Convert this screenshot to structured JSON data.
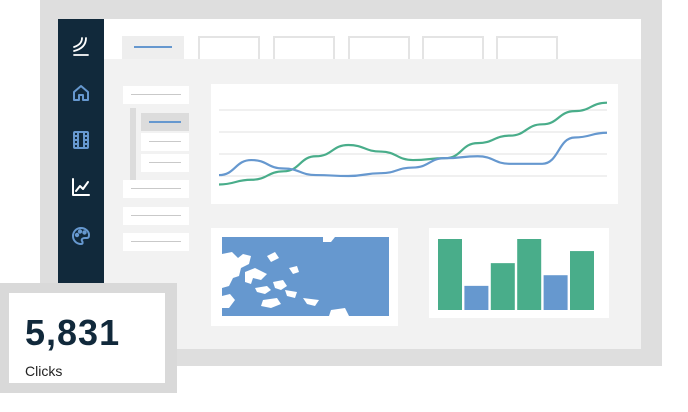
{
  "colors": {
    "sidebar": "#11293b",
    "icon": "#6698cf",
    "green": "#49ad8a",
    "blue": "#6698cf",
    "frame": "#dedede"
  },
  "sidebar": {
    "icons": [
      "logo-icon",
      "home-icon",
      "film-icon",
      "chart-icon",
      "palette-icon"
    ]
  },
  "tabs": {
    "count": 6,
    "active_index": 0
  },
  "line_chart": {
    "type": "line",
    "series": [
      {
        "color": "#49ad8a",
        "values": [
          0.08,
          0.13,
          0.22,
          0.38,
          0.5,
          0.43,
          0.34,
          0.36,
          0.52,
          0.6,
          0.72,
          0.86,
          0.95
        ]
      },
      {
        "color": "#6698cf",
        "values": [
          0.18,
          0.34,
          0.25,
          0.18,
          0.17,
          0.2,
          0.26,
          0.36,
          0.38,
          0.3,
          0.3,
          0.58,
          0.63
        ]
      }
    ],
    "grid": true
  },
  "bar_chart": {
    "type": "bar",
    "series_colors": [
      "#49ad8a",
      "#6698cf",
      "#49ad8a",
      "#49ad8a",
      "#6698cf",
      "#49ad8a"
    ],
    "values": [
      1.0,
      0.34,
      0.66,
      1.0,
      0.49,
      0.83
    ]
  },
  "stat": {
    "value": "5,831",
    "label": "Clicks"
  }
}
